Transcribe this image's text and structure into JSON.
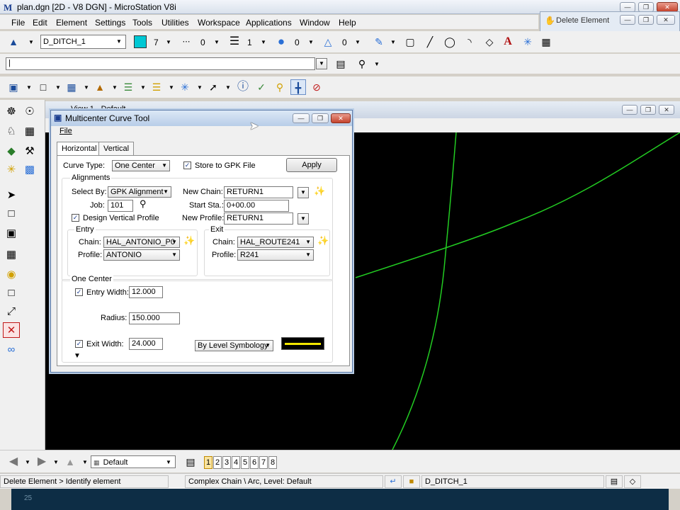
{
  "window": {
    "title": "plan.dgn [2D - V8 DGN] - MicroStation V8i",
    "app_icon": "M"
  },
  "menu": [
    "File",
    "Edit",
    "Element",
    "Settings",
    "Tools",
    "Utilities",
    "Workspace",
    "Applications",
    "Window",
    "Help"
  ],
  "attributes": {
    "level": "D_DITCH_1",
    "color": "7",
    "style": "0",
    "weight": "1",
    "transparency": "0",
    "priority": "0",
    "fill_color": "#00c8d4"
  },
  "command_input": "|",
  "delete_element_window": {
    "title": "Delete Element"
  },
  "view_window": {
    "title": "View 1 - Default"
  },
  "dialog": {
    "title": "Multicenter Curve Tool",
    "menu_file": "File",
    "tabs": [
      "Horizontal",
      "Vertical"
    ],
    "curve_type_label": "Curve Type:",
    "curve_type_value": "One Center",
    "store_gpk_label": "Store to GPK File",
    "store_gpk_checked": true,
    "apply_label": "Apply",
    "alignments_title": "Alignments",
    "select_by_label": "Select By:",
    "select_by_value": "GPK Alignment",
    "new_chain_label": "New Chain:",
    "new_chain_value": "RETURN1",
    "job_label": "Job:",
    "job_value": "101",
    "start_sta_label": "Start Sta.:",
    "start_sta_value": "0+00.00",
    "design_vertical_label": "Design Vertical Profile",
    "design_vertical_checked": true,
    "new_profile_label": "New Profile:",
    "new_profile_value": "RETURN1",
    "entry_title": "Entry",
    "entry_chain_label": "Chain:",
    "entry_chain_value": "HAL_ANTONIO_P0",
    "entry_profile_label": "Profile:",
    "entry_profile_value": "ANTONIO",
    "exit_title": "Exit",
    "exit_chain_label": "Chain:",
    "exit_chain_value": "HAL_ROUTE241",
    "exit_profile_label": "Profile:",
    "exit_profile_value": "R241",
    "one_center_title": "One Center",
    "entry_width_label": "Entry Width:",
    "entry_width_value": "12.000",
    "entry_width_checked": true,
    "radius_label": "Radius:",
    "radius_value": "150.000",
    "exit_width_label": "Exit Width:",
    "exit_width_value": "24.000",
    "exit_width_checked": true,
    "symbology_value": "By Level Symbology",
    "symbology_line_color": "#f2e600"
  },
  "bottom_toolbar": {
    "view_group": "Default",
    "views": [
      "1",
      "2",
      "3",
      "4",
      "5",
      "6",
      "7",
      "8"
    ],
    "active_view": "1"
  },
  "status": {
    "prompt": "Delete Element > Identify element",
    "message": "Complex Chain \\ Arc, Level: Default",
    "level": "D_DITCH_1"
  },
  "footer": {
    "page_number": "25"
  },
  "colors": {
    "canvas_bg": "#000000",
    "curve_green": "#22cc22",
    "footer_bg": "#0d2d45"
  }
}
